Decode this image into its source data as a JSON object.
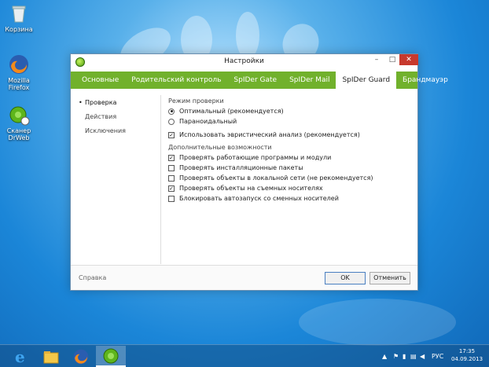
{
  "desktop": {
    "icons": [
      {
        "label": "Корзина",
        "icon": "recycle-bin-icon"
      },
      {
        "label": "Mozilla Firefox",
        "icon": "firefox-icon"
      },
      {
        "label": "Сканер DrWeb",
        "icon": "drweb-scanner-icon"
      }
    ]
  },
  "window": {
    "title": "Настройки",
    "controls": {
      "minimize": "–",
      "maximize": "□",
      "close": "✕"
    },
    "tabs": [
      {
        "label": "Основные",
        "active": false
      },
      {
        "label": "Родительский контроль",
        "active": false
      },
      {
        "label": "SpIDer Gate",
        "active": false
      },
      {
        "label": "SpIDer Mail",
        "active": false
      },
      {
        "label": "SpIDer Guard",
        "active": true
      },
      {
        "label": "Брандмауэр",
        "active": false
      }
    ],
    "sidebar": [
      {
        "label": "Проверка",
        "active": true
      },
      {
        "label": "Действия",
        "active": false
      },
      {
        "label": "Исключения",
        "active": false
      }
    ],
    "content": {
      "scan_mode_title": "Режим проверки",
      "radio_options": [
        {
          "label": "Оптимальный (рекомендуется)",
          "checked": true
        },
        {
          "label": "Параноидальный",
          "checked": false
        }
      ],
      "heuristic": {
        "label": "Использовать эвристический анализ (рекомендуется)",
        "checked": true
      },
      "extra_title": "Дополнительные возможности",
      "extra_options": [
        {
          "label": "Проверять работающие программы и модули",
          "checked": true
        },
        {
          "label": "Проверять инсталляционные пакеты",
          "checked": false
        },
        {
          "label": "Проверять объекты в локальной сети (не рекомендуется)",
          "checked": false
        },
        {
          "label": "Проверять объекты на съемных носителях",
          "checked": true
        },
        {
          "label": "Блокировать автозапуск со сменных носителей",
          "checked": false
        }
      ]
    },
    "footer": {
      "help": "Справка",
      "ok": "OK",
      "cancel": "Отменить"
    }
  },
  "taskbar": {
    "items": [
      "ie-icon",
      "explorer-icon",
      "firefox-icon",
      "drweb-icon"
    ],
    "language": "РУС",
    "time": "17:35",
    "date": "04.09.2013"
  },
  "colors": {
    "accent_green": "#71b12c",
    "close_red": "#c7392d"
  }
}
